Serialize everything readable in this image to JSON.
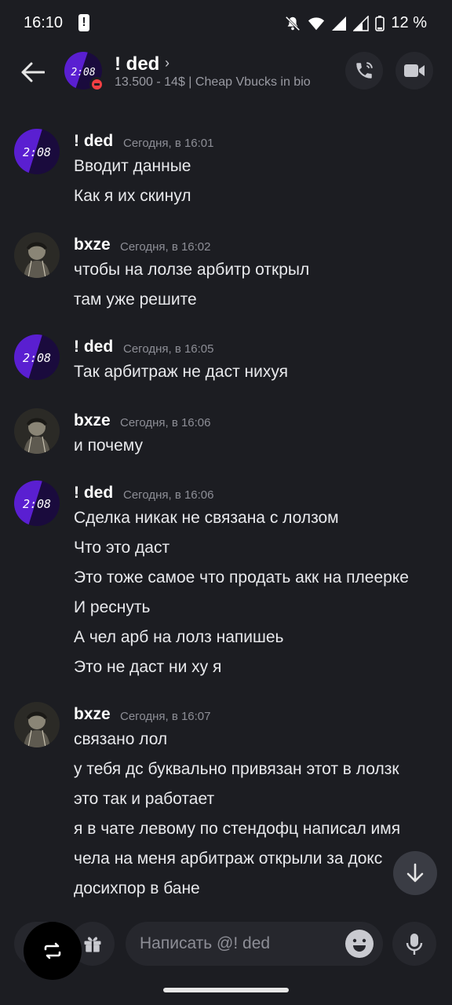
{
  "status_bar": {
    "time": "16:10",
    "alert": "!",
    "battery": "12 %"
  },
  "header": {
    "name": "! ded",
    "chevron": "›",
    "status": "13.500 - 14$ | Cheap Vbucks in bio",
    "avatar_text": "2:08"
  },
  "messages": [
    {
      "author": "! ded",
      "time": "Сегодня, в 16:01",
      "avatar": "clock",
      "avatar_text": "2:08",
      "lines": [
        "Вводит данные",
        "Как я их скинул"
      ]
    },
    {
      "author": "bxze",
      "time": "Сегодня, в 16:02",
      "avatar": "dark",
      "lines": [
        "чтобы на лолзе арбитр открыл",
        "там уже решите"
      ]
    },
    {
      "author": "! ded",
      "time": "Сегодня, в 16:05",
      "avatar": "clock",
      "avatar_text": "2:08",
      "lines": [
        "Так арбитраж не даст нихуя"
      ]
    },
    {
      "author": "bxze",
      "time": "Сегодня, в 16:06",
      "avatar": "dark",
      "lines": [
        "и почему"
      ]
    },
    {
      "author": "! ded",
      "time": "Сегодня, в 16:06",
      "avatar": "clock",
      "avatar_text": "2:08",
      "lines": [
        "Сделка никак не связана с лолзом",
        "Что это даст",
        "Это тоже самое что продать акк на плеерке",
        "И реснуть",
        "А чел арб на лолз напишеь",
        "Это не даст ни ху я"
      ]
    },
    {
      "author": "bxze",
      "time": "Сегодня, в 16:07",
      "avatar": "dark",
      "lines": [
        "связано лол",
        "у тебя дс буквально привязан этот в лолзк",
        "это так и работает",
        "я в чате левому по стендофц написал имя",
        "чела на меня арбитраж открыли за докс",
        "досихпор в бане"
      ]
    }
  ],
  "composer": {
    "placeholder": "Написать @! ded"
  },
  "icons": {
    "back": "arrow-left-icon",
    "call": "phone-icon",
    "video": "video-icon",
    "scroll": "arrow-down-icon",
    "fab": "switch-icon",
    "gift": "gift-icon",
    "emoji": "emoji-icon",
    "mic": "mic-icon"
  },
  "colors": {
    "background": "#1c1d22",
    "dnd": "#f23f43",
    "avatar_purple": "#5a1fd1"
  }
}
